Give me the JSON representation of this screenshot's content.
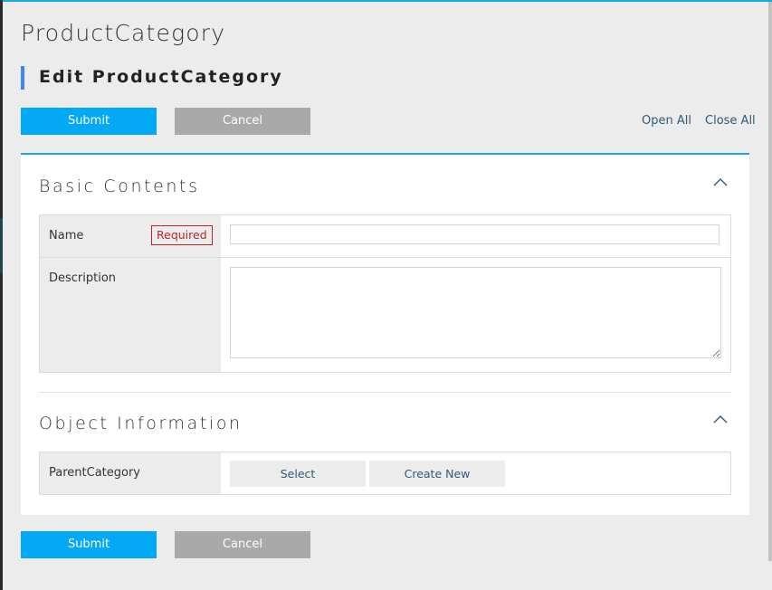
{
  "page": {
    "title": "ProductCategory",
    "subtitle": "Edit ProductCategory"
  },
  "toolbar": {
    "submit_label": "Submit",
    "cancel_label": "Cancel",
    "open_all_label": "Open All",
    "close_all_label": "Close All"
  },
  "sections": [
    {
      "title": "Basic Contents",
      "toggle_icon": "chevron-up-icon",
      "fields": [
        {
          "label": "Name",
          "badge": "Required",
          "type": "text",
          "value": "",
          "placeholder": ""
        },
        {
          "label": "Description",
          "type": "textarea",
          "value": "",
          "placeholder": ""
        }
      ]
    },
    {
      "title": "Object Information",
      "toggle_icon": "chevron-up-icon",
      "fields": [
        {
          "label": "ParentCategory",
          "type": "reference",
          "actions": [
            "Select",
            "Create New"
          ]
        }
      ]
    }
  ],
  "footer": {
    "submit_label": "Submit",
    "cancel_label": "Cancel"
  },
  "colors": {
    "accent": "#03a9f4",
    "cancel": "#a9a9a9",
    "required": "#b5272d",
    "title_bar": "#3f86f2",
    "link": "#2d5a7a"
  }
}
